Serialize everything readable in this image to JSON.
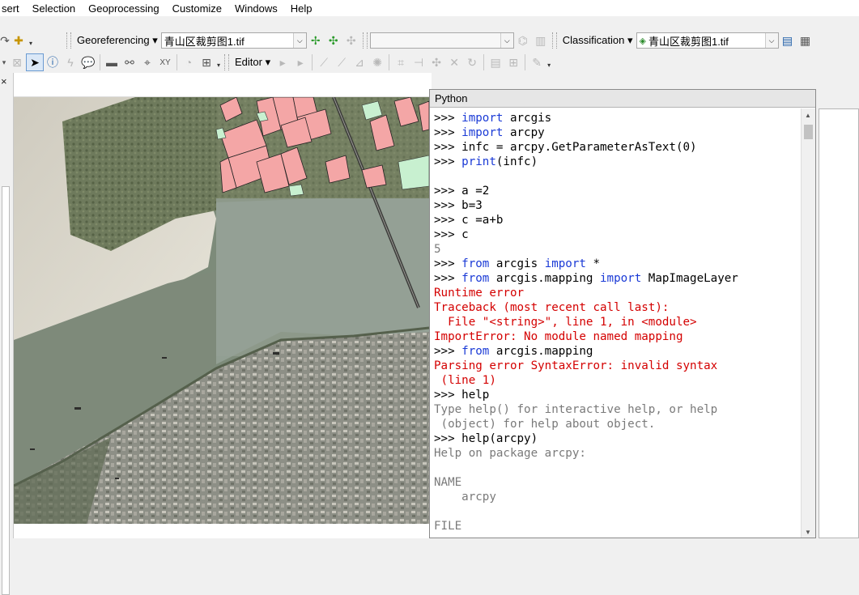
{
  "menu": {
    "items": [
      "sert",
      "Selection",
      "Geoprocessing",
      "Customize",
      "Windows",
      "Help"
    ]
  },
  "toolbar1": {
    "georef_label": "Georeferencing",
    "georef_layer": "青山区裁剪图1.tif",
    "classification_label": "Classification",
    "class_layer": "青山区裁剪图1.tif"
  },
  "toolbar2": {
    "editor_label": "Editor"
  },
  "left_panel": {
    "close_glyph": "×"
  },
  "python": {
    "title": "Python",
    "lines": [
      {
        "segs": [
          {
            "t": ">>> ",
            "c": "pl"
          },
          {
            "t": "import",
            "c": "kw"
          },
          {
            "t": " arcgis",
            "c": "pl"
          }
        ]
      },
      {
        "segs": [
          {
            "t": ">>> ",
            "c": "pl"
          },
          {
            "t": "import",
            "c": "kw"
          },
          {
            "t": " arcpy",
            "c": "pl"
          }
        ]
      },
      {
        "segs": [
          {
            "t": ">>> infc = arcpy.GetParameterAsText(0)",
            "c": "pl"
          }
        ]
      },
      {
        "segs": [
          {
            "t": ">>> ",
            "c": "pl"
          },
          {
            "t": "print",
            "c": "kw"
          },
          {
            "t": "(infc)",
            "c": "pl"
          }
        ]
      },
      {
        "segs": [
          {
            "t": "",
            "c": "pl"
          }
        ]
      },
      {
        "segs": [
          {
            "t": ">>> a =2",
            "c": "pl"
          }
        ]
      },
      {
        "segs": [
          {
            "t": ">>> b=3",
            "c": "pl"
          }
        ]
      },
      {
        "segs": [
          {
            "t": ">>> c =a+b",
            "c": "pl"
          }
        ]
      },
      {
        "segs": [
          {
            "t": ">>> c",
            "c": "pl"
          }
        ]
      },
      {
        "segs": [
          {
            "t": "5",
            "c": "nm"
          }
        ]
      },
      {
        "segs": [
          {
            "t": ">>> ",
            "c": "pl"
          },
          {
            "t": "from",
            "c": "kw"
          },
          {
            "t": " arcgis ",
            "c": "pl"
          },
          {
            "t": "import",
            "c": "kw"
          },
          {
            "t": " *",
            "c": "pl"
          }
        ]
      },
      {
        "segs": [
          {
            "t": ">>> ",
            "c": "pl"
          },
          {
            "t": "from",
            "c": "kw"
          },
          {
            "t": " arcgis.mapping ",
            "c": "pl"
          },
          {
            "t": "import",
            "c": "kw"
          },
          {
            "t": " MapImageLayer",
            "c": "pl"
          }
        ]
      },
      {
        "segs": [
          {
            "t": "Runtime error",
            "c": "er"
          }
        ]
      },
      {
        "segs": [
          {
            "t": "Traceback (most recent call last):",
            "c": "er"
          }
        ]
      },
      {
        "segs": [
          {
            "t": "  File \"<string>\", line 1, in <module>",
            "c": "er"
          }
        ]
      },
      {
        "segs": [
          {
            "t": "ImportError: No module named mapping",
            "c": "er"
          }
        ]
      },
      {
        "segs": [
          {
            "t": ">>> ",
            "c": "pl"
          },
          {
            "t": "from",
            "c": "kw"
          },
          {
            "t": " arcgis.mapping",
            "c": "pl"
          }
        ]
      },
      {
        "segs": [
          {
            "t": "Parsing error SyntaxError: invalid syntax",
            "c": "er"
          }
        ]
      },
      {
        "segs": [
          {
            "t": " (line 1)",
            "c": "er"
          }
        ]
      },
      {
        "segs": [
          {
            "t": ">>> help",
            "c": "pl"
          }
        ]
      },
      {
        "segs": [
          {
            "t": "Type help() for interactive help, or help",
            "c": "ou"
          }
        ]
      },
      {
        "segs": [
          {
            "t": " (object) for help about object.",
            "c": "ou"
          }
        ]
      },
      {
        "segs": [
          {
            "t": ">>> help(arcpy)",
            "c": "pl"
          }
        ]
      },
      {
        "segs": [
          {
            "t": "Help on package arcpy:",
            "c": "ou"
          }
        ]
      },
      {
        "segs": [
          {
            "t": "",
            "c": "ou"
          }
        ]
      },
      {
        "segs": [
          {
            "t": "NAME",
            "c": "ou"
          }
        ]
      },
      {
        "segs": [
          {
            "t": "    arcpy",
            "c": "ou"
          }
        ]
      },
      {
        "segs": [
          {
            "t": "",
            "c": "ou"
          }
        ]
      },
      {
        "segs": [
          {
            "t": "FILE",
            "c": "ou"
          }
        ]
      }
    ]
  },
  "colors": {
    "keyword": "#1a3ad6",
    "error": "#d40000",
    "output": "#7a7a7a",
    "parcel_fill": "#f4a6a6",
    "parcel_green": "#c8f0d0"
  },
  "icons": {
    "pointer": "select-arrow-icon",
    "identify": "info-icon",
    "find": "binoculars-icon"
  }
}
